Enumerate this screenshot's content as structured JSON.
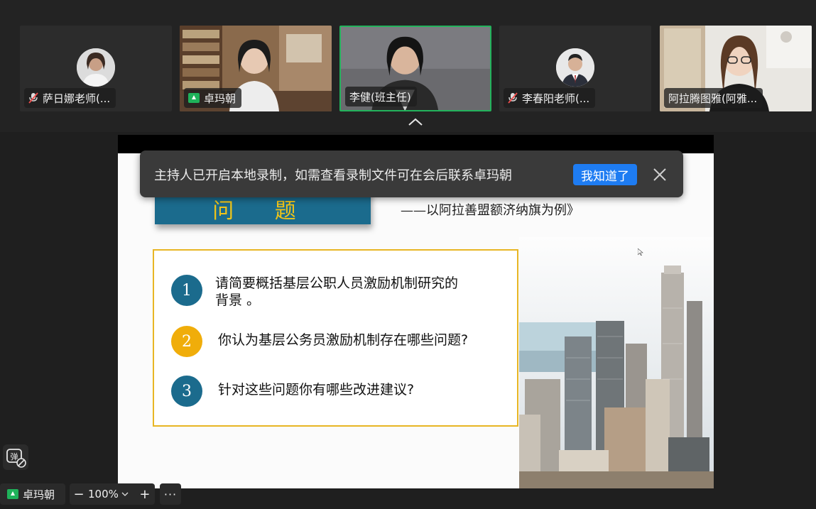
{
  "participants": [
    {
      "name": "萨日娜老师(...",
      "muted": true,
      "video": "avatar"
    },
    {
      "name": "卓玛朝",
      "sharing": true,
      "video": "camera"
    },
    {
      "name": "李健(班主任)",
      "speaking": true,
      "video": "camera"
    },
    {
      "name": "李春阳老师(...",
      "muted": true,
      "video": "avatar"
    },
    {
      "name": "阿拉腾图雅(阿雅...",
      "video": "camera"
    }
  ],
  "slide": {
    "title": "问 题",
    "subtitle": "——以阿拉善盟额济纳旗为例》",
    "questions": [
      {
        "number": "1",
        "text_line1": "请简要概括基层公职人员激励机制研究的",
        "text_line2": "背景 。",
        "color": "#1b6b8d"
      },
      {
        "number": "2",
        "text": "你认为基层公务员激励机制存在哪些问题?",
        "color": "#f0ad0a"
      },
      {
        "number": "3",
        "text": "针对这些问题你有哪些改进建议?",
        "color": "#1b6b8d"
      }
    ]
  },
  "notice": {
    "text": "主持人已开启本地录制，如需查看录制文件可在会后联系卓玛朝",
    "ok_label": "我知道了"
  },
  "bottom": {
    "sharer_name": "卓玛朝",
    "zoom_out": "−",
    "zoom_value": "100%",
    "zoom_in": "+",
    "more": "···",
    "danmu_icon": "danmu-off-icon"
  },
  "colors": {
    "speaking_border": "#23b35c",
    "accent_blue": "#1e7cf2",
    "slide_blue": "#1b6b8d",
    "slide_gold": "#f0ad0a"
  }
}
